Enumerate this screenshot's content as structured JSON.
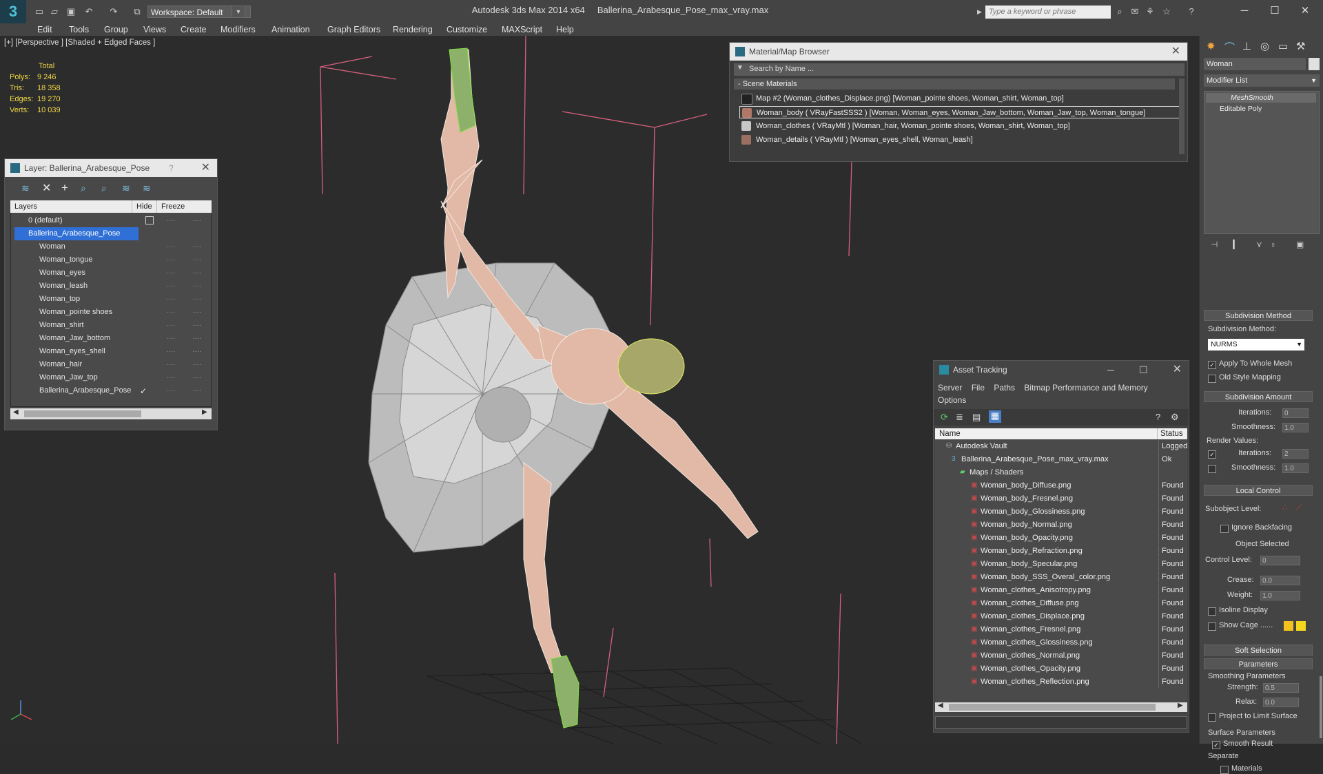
{
  "title_bar": {
    "workspace": "Workspace: Default",
    "app_name": "Autodesk 3ds Max  2014 x64",
    "file_name": "Ballerina_Arabesque_Pose_max_vray.max",
    "search_placeholder": "Type a keyword or phrase"
  },
  "menu": [
    "Edit",
    "Tools",
    "Group",
    "Views",
    "Create",
    "Modifiers",
    "Animation",
    "Graph Editors",
    "Rendering",
    "Customize",
    "MAXScript",
    "Help"
  ],
  "viewport": {
    "label": "[+] [Perspective ] [Shaded + Edged Faces ]",
    "stats_header": "Total",
    "stats": [
      {
        "label": "Polys:",
        "value": "9 246"
      },
      {
        "label": "Tris:",
        "value": "18 358"
      },
      {
        "label": "Edges:",
        "value": "19 270"
      },
      {
        "label": "Verts:",
        "value": "10 039"
      }
    ]
  },
  "layer_panel": {
    "title": "Layer: Ballerina_Arabesque_Pose",
    "help": "?",
    "columns": [
      "Layers",
      "Hide",
      "Freeze"
    ],
    "rows": [
      "0 (default)",
      "Ballerina_Arabesque_Pose",
      "Woman",
      "Woman_tongue",
      "Woman_eyes",
      "Woman_leash",
      "Woman_top",
      "Woman_pointe shoes",
      "Woman_shirt",
      "Woman_Jaw_bottom",
      "Woman_eyes_shell",
      "Woman_hair",
      "Woman_Jaw_top",
      "Ballerina_Arabesque_Pose"
    ]
  },
  "material_browser": {
    "title": "Material/Map Browser",
    "search_placeholder": "Search by Name ...",
    "section": "Scene Materials",
    "items": [
      "Map #2 (Woman_clothes_Displace.png) [Woman_pointe shoes, Woman_shirt, Woman_top]",
      "Woman_body  ( VRayFastSSS2 ) [Woman, Woman_eyes, Woman_Jaw_bottom, Woman_Jaw_top, Woman_tongue]",
      "Woman_clothes  ( VRayMtl ) [Woman_hair, Woman_pointe shoes, Woman_shirt, Woman_top]",
      "Woman_details  ( VRayMtl ) [Woman_eyes_shell, Woman_leash]"
    ]
  },
  "asset_tracking": {
    "title": "Asset Tracking",
    "menu": [
      "Server",
      "File",
      "Paths",
      "Bitmap Performance and Memory",
      "Options"
    ],
    "columns": [
      "Name",
      "Status"
    ],
    "rows": [
      {
        "name": "Autodesk Vault",
        "status": "Logged O"
      },
      {
        "name": "Ballerina_Arabesque_Pose_max_vray.max",
        "status": "Ok"
      },
      {
        "name": "Maps / Shaders",
        "status": ""
      },
      {
        "name": "Woman_body_Diffuse.png",
        "status": "Found"
      },
      {
        "name": "Woman_body_Fresnel.png",
        "status": "Found"
      },
      {
        "name": "Woman_body_Glossiness.png",
        "status": "Found"
      },
      {
        "name": "Woman_body_Normal.png",
        "status": "Found"
      },
      {
        "name": "Woman_body_Opacity.png",
        "status": "Found"
      },
      {
        "name": "Woman_body_Refraction.png",
        "status": "Found"
      },
      {
        "name": "Woman_body_Specular.png",
        "status": "Found"
      },
      {
        "name": "Woman_body_SSS_Overal_color.png",
        "status": "Found"
      },
      {
        "name": "Woman_clothes_Anisotropy.png",
        "status": "Found"
      },
      {
        "name": "Woman_clothes_Diffuse.png",
        "status": "Found"
      },
      {
        "name": "Woman_clothes_Displace.png",
        "status": "Found"
      },
      {
        "name": "Woman_clothes_Fresnel.png",
        "status": "Found"
      },
      {
        "name": "Woman_clothes_Glossiness.png",
        "status": "Found"
      },
      {
        "name": "Woman_clothes_Normal.png",
        "status": "Found"
      },
      {
        "name": "Woman_clothes_Opacity.png",
        "status": "Found"
      },
      {
        "name": "Woman_clothes_Reflection.png",
        "status": "Found"
      }
    ]
  },
  "command_panel": {
    "object_name": "Woman",
    "modifier_list": "Modifier List",
    "stack": [
      "MeshSmooth",
      "Editable Poly"
    ],
    "subdivision_method": {
      "header": "Subdivision Method",
      "label": "Subdivision Method:",
      "value": "NURMS",
      "apply_whole": "Apply To Whole Mesh",
      "old_style": "Old Style Mapping"
    },
    "subdivision_amount": {
      "header": "Subdivision Amount",
      "iterations_label": "Iterations:",
      "iterations": "0",
      "smoothness_label": "Smoothness:",
      "smoothness": "1.0",
      "render_values": "Render Values:",
      "render_iterations": "2",
      "render_smoothness": "1.0"
    },
    "local_control": {
      "header": "Local Control",
      "subobject": "Subobject Level:",
      "ignore_backfacing": "Ignore Backfacing",
      "object_selected": "Object Selected",
      "control_level_label": "Control Level:",
      "control_level": "0",
      "crease_label": "Crease:",
      "crease": "0.0",
      "weight_label": "Weight:",
      "weight": "1.0",
      "isoline": "Isoline Display",
      "show_cage": "Show Cage ......"
    },
    "soft_selection": "Soft Selection",
    "parameters": {
      "header": "Parameters",
      "smoothing": "Smoothing Parameters",
      "strength_label": "Strength:",
      "strength": "0.5",
      "relax_label": "Relax:",
      "relax": "0.0",
      "project": "Project to Limit Surface",
      "surface": "Surface Parameters",
      "smooth_result": "Smooth Result",
      "separate": "Separate",
      "materials": "Materials"
    }
  }
}
